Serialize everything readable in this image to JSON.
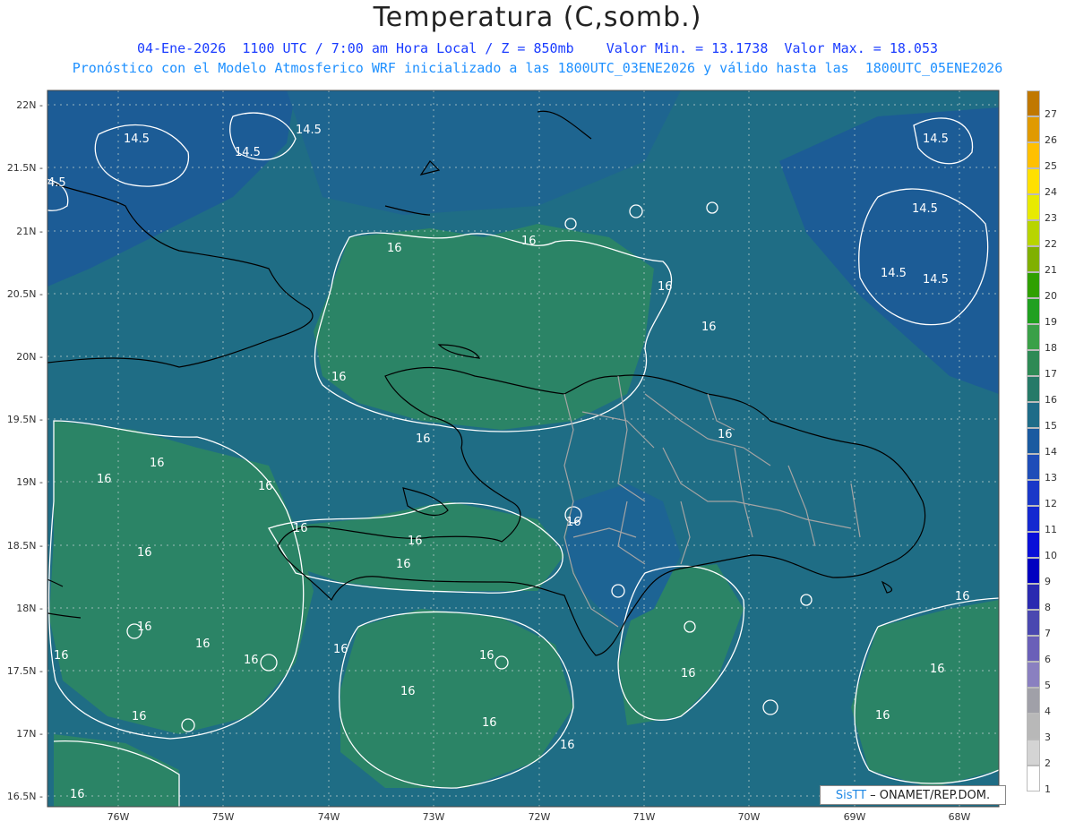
{
  "header": {
    "title": "Temperatura (C,somb.)",
    "line1": "04-Ene-2026  1100 UTC / 7:00 am Hora Local / Z = 850mb    Valor Min. = 13.1738  Valor Max. = 18.053",
    "line2": "Pronóstico con el Modelo Atmosferico WRF inicializado a las 1800UTC_03ENE2026 y válido hasta las  1800UTC_05ENE2026"
  },
  "axes": {
    "lat_labels": [
      "22N",
      "21.5N",
      "21N",
      "20.5N",
      "20N",
      "19.5N",
      "19N",
      "18.5N",
      "18N",
      "17.5N",
      "17N",
      "16.5N"
    ],
    "lon_labels": [
      "76W",
      "75W",
      "74W",
      "73W",
      "72W",
      "71W",
      "70W",
      "69W",
      "68W"
    ]
  },
  "contour_labels": [
    "14.5",
    "14.5",
    "14.5",
    "4.5",
    "14.5",
    "14.5",
    "14.5",
    "14.5",
    "16",
    "16",
    "16",
    "16",
    "16",
    "16",
    "16",
    "16",
    "16",
    "16",
    "16",
    "16",
    "16",
    "16",
    "16",
    "16",
    "16",
    "16",
    "16",
    "16",
    "16",
    "16",
    "16",
    "16",
    "16",
    "16",
    "16",
    "16",
    "16",
    "16"
  ],
  "colorbar": {
    "labels": [
      "27",
      "26",
      "25",
      "24",
      "23",
      "22",
      "21",
      "20",
      "19",
      "18",
      "17",
      "16",
      "15",
      "14",
      "13",
      "12",
      "11",
      "10",
      "9",
      "8",
      "7",
      "6",
      "5",
      "4",
      "3",
      "2",
      "1"
    ],
    "colors": [
      "#c07800",
      "#e09a00",
      "#ffc000",
      "#ffe000",
      "#e8ea00",
      "#b8d400",
      "#80b000",
      "#30a000",
      "#20a020",
      "#3aa048",
      "#2e8a55",
      "#267a68",
      "#1f6c88",
      "#1a5aa0",
      "#1f4db8",
      "#1a38c8",
      "#1428d0",
      "#0a10d8",
      "#0000c0",
      "#2a2ab0",
      "#4a48b0",
      "#6a60b8",
      "#8a80c0",
      "#a0a0a8",
      "#b8b8b8",
      "#d4d4d4",
      "#ffffff"
    ]
  },
  "credit": {
    "brand": "SisTT",
    "org": "– ONAMET/REP.DOM."
  }
}
